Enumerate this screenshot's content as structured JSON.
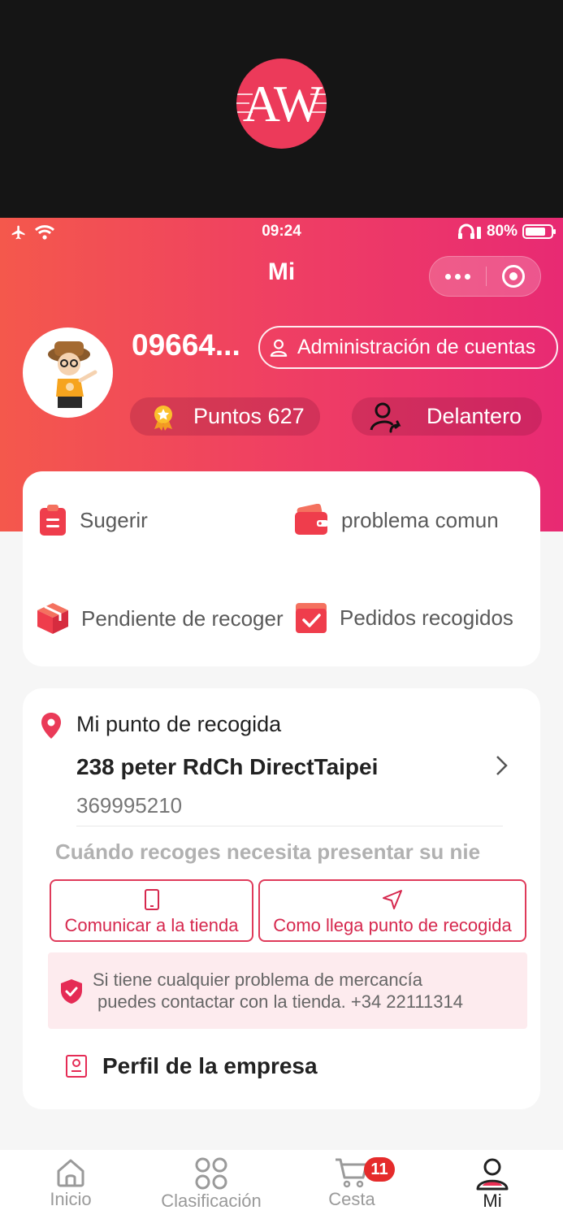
{
  "splash": {
    "logo_text": "AW"
  },
  "status_bar": {
    "time": "09:24",
    "battery": "80%",
    "battery_level": 0.8
  },
  "nav": {
    "title": "Mi",
    "more_icon": "more-dots-icon",
    "close_icon": "target-icon"
  },
  "profile": {
    "username": "09664...",
    "account_button": "Administración de cuentas",
    "points": "Puntos 627",
    "front": "Delantero"
  },
  "actions": [
    {
      "label": "Sugerir",
      "icon": "clipboard-icon"
    },
    {
      "label": "problema comun",
      "icon": "wallet-icon"
    },
    {
      "label": "Pendiente de recoger",
      "icon": "package-icon"
    },
    {
      "label": "Pedidos recogidos",
      "icon": "check-box-icon"
    }
  ],
  "pickup": {
    "title": "Mi punto de recogida",
    "address": "238 peter RdCh DirectTaipei",
    "phone": "369995210",
    "notice": "Cuándo recoges necesita presentar su nie",
    "contact_button": "Comunicar a la tienda",
    "directions_button": "Como llega punto de recogida",
    "warning_line1": "Si tiene cualquier problema de mercancía",
    "warning_line2": "puedes contactar con la tienda. +34 22111314",
    "company_profile": "Perfil de la empresa"
  },
  "tabbar": {
    "tabs": [
      {
        "label": "Inicio",
        "icon": "home-icon"
      },
      {
        "label": "Clasificación",
        "icon": "grid-icon"
      },
      {
        "label": "Cesta",
        "icon": "cart-icon"
      },
      {
        "label": "Mi",
        "icon": "user-icon"
      }
    ],
    "cart_badge": "11",
    "active": "Mi"
  },
  "colors": {
    "accent": "#ef3f63",
    "gradient_start": "#f4584c",
    "gradient_end": "#e82a73",
    "badge": "#e52b2b"
  }
}
